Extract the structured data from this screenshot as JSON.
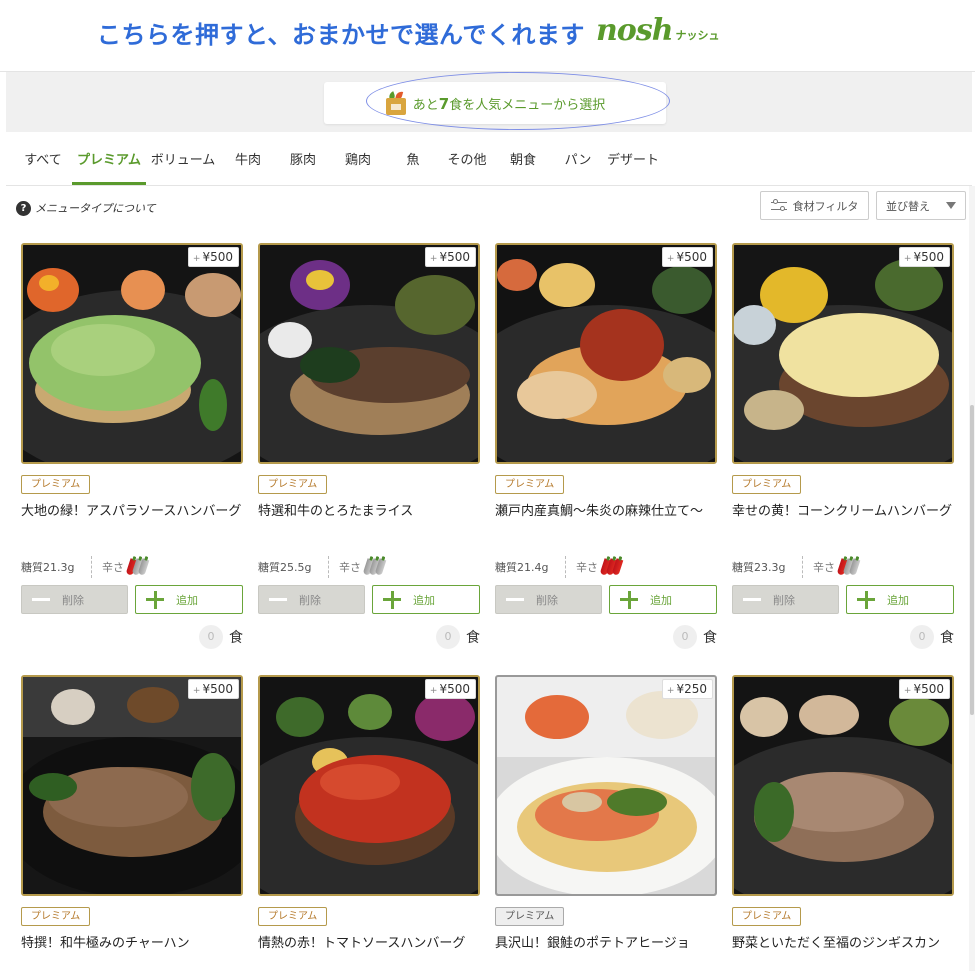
{
  "banner": {
    "text": "こちらを押すと、おまかせで選んでくれます",
    "brand_logo": "nosh",
    "brand_kana": "ナッシュ"
  },
  "popular_select": {
    "prefix": "あと",
    "count": "7",
    "suffix": "食を人気メニューから選択"
  },
  "tabs": [
    {
      "label": "すべて",
      "active": false
    },
    {
      "label": "プレミアム",
      "active": true
    },
    {
      "label": "ボリューム",
      "active": false
    },
    {
      "label": "牛肉",
      "active": false
    },
    {
      "label": "豚肉",
      "active": false
    },
    {
      "label": "鶏肉",
      "active": false
    },
    {
      "label": "魚",
      "active": false
    },
    {
      "label": "その他",
      "active": false
    },
    {
      "label": "朝食",
      "active": false
    },
    {
      "label": "パン",
      "active": false
    },
    {
      "label": "デザート",
      "active": false
    }
  ],
  "toolbar": {
    "menu_type_icon": "?",
    "menu_type_label": "メニュータイプについて",
    "filter_label": "食材フィルタ",
    "sort_label": "並び替え"
  },
  "card_common": {
    "plus": "+",
    "spice_label": "辛さ",
    "remove_label": "削除",
    "add_label": "追加",
    "qty_unit": "食"
  },
  "products": [
    {
      "name": "大地の緑！アスパラソースハンバーグ",
      "price": "¥500",
      "tag": "プレミアム",
      "carb": "糖質21.3g",
      "spice": 1,
      "qty": "0"
    },
    {
      "name": "特選和牛のとろたまライス",
      "price": "¥500",
      "tag": "プレミアム",
      "carb": "糖質25.5g",
      "spice": 0,
      "qty": "0"
    },
    {
      "name": "瀬戸内産真鯛〜朱炎の麻辣仕立て〜",
      "price": "¥500",
      "tag": "プレミアム",
      "carb": "糖質21.4g",
      "spice": 3,
      "qty": "0"
    },
    {
      "name": "幸せの黄！コーンクリームハンバーグ",
      "price": "¥500",
      "tag": "プレミアム",
      "carb": "糖質23.3g",
      "spice": 1,
      "qty": "0"
    },
    {
      "name": "特撰！和牛極みのチャーハン",
      "price": "¥500",
      "tag": "プレミアム"
    },
    {
      "name": "情熱の赤！トマトソースハンバーグ",
      "price": "¥500",
      "tag": "プレミアム"
    },
    {
      "name": "具沢山！銀鮭のポテトアヒージョ",
      "price": "¥250",
      "tag": "プレミアム"
    },
    {
      "name": "野菜といただく至福のジンギスカン",
      "price": "¥500",
      "tag": "プレミアム"
    }
  ],
  "colors": {
    "brand_green": "#5a9a2c",
    "banner_blue": "#2f6bd8",
    "premium_border": "#b59a4c",
    "chili_red": "#d41b1e"
  }
}
